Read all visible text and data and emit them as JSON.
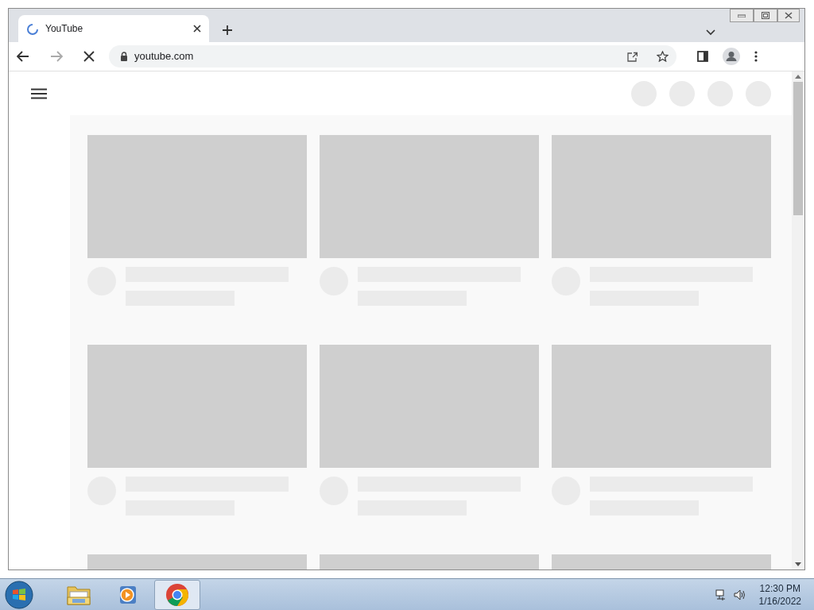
{
  "browser_tab": {
    "title": "YouTube",
    "loading": true,
    "selected": true
  },
  "address_bar": {
    "url": "youtube.com"
  },
  "taskbar": {
    "apps": [
      {
        "kind": "folder",
        "selected": false
      },
      {
        "kind": "player",
        "selected": false
      },
      {
        "kind": "chrome",
        "selected": true
      }
    ],
    "clock": {
      "time": "12:30 PM",
      "date": "1/16/2022"
    }
  }
}
